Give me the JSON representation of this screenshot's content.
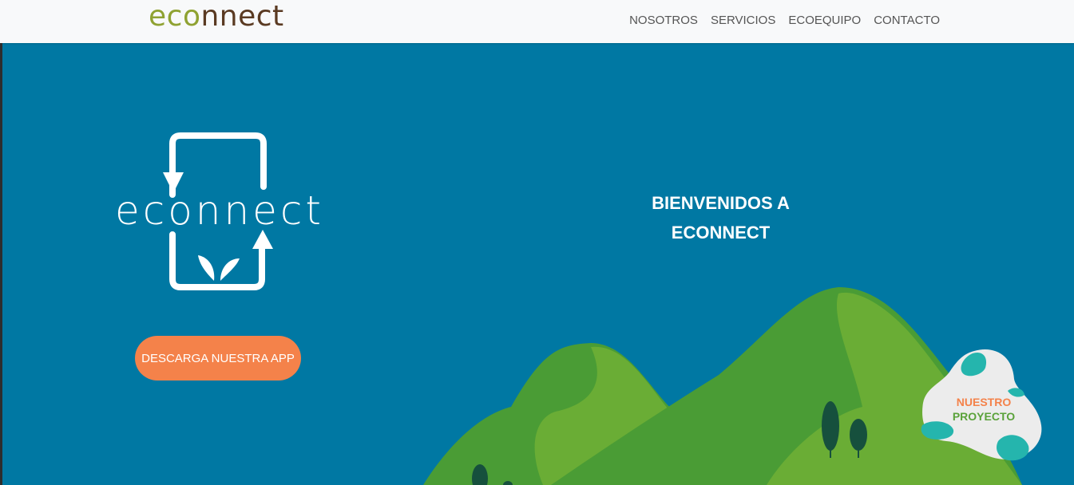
{
  "navbar": {
    "brand_part1": "eco",
    "brand_part2": "nnect",
    "links": [
      "NOSOTROS",
      "SERVICIOS",
      "ECOEQUIPO",
      "CONTACTO"
    ]
  },
  "hero": {
    "logo_text": "econnect",
    "download_button": "DESCARGA NUESTRA APP",
    "welcome_line1": "BIENVENIDOS A",
    "welcome_line2": "ECONNECT"
  },
  "project_badge": {
    "line1": "NUESTRO",
    "line2": "PROYECTO"
  },
  "colors": {
    "background": "#0078a3",
    "button": "#f4824a",
    "brand_green": "#8fa232",
    "brand_brown": "#5a3a22"
  }
}
